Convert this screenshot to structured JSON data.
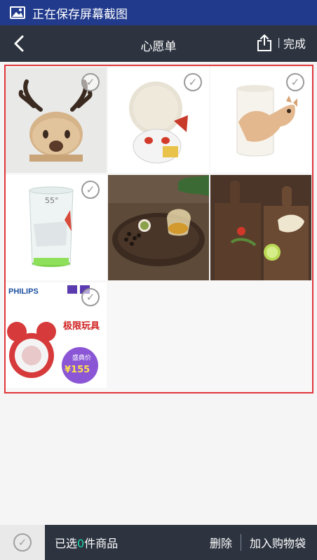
{
  "status": {
    "text": "正在保存屏幕截图"
  },
  "nav": {
    "title": "心愿单",
    "done_label": "完成"
  },
  "items": [
    {
      "name": "deer-wooden-ornament",
      "checked": false
    },
    {
      "name": "lucky-cat-figure",
      "checked": false
    },
    {
      "name": "cat-mug",
      "checked": false
    },
    {
      "name": "glass-cup",
      "checked": false,
      "cup_text": "55°"
    },
    {
      "name": "tea-set",
      "checked": false
    },
    {
      "name": "cutting-boards",
      "checked": false
    },
    {
      "name": "mickey-alarm-clock",
      "checked": false,
      "brand": "PHILIPS",
      "promo_text": "极限玩具",
      "price_badge": "盛典价",
      "price": "¥155"
    }
  ],
  "bottom": {
    "selected_prefix": "已选",
    "selected_count": "0",
    "selected_suffix": "件商品",
    "delete_label": "删除",
    "add_to_cart_label": "加入购物袋"
  }
}
